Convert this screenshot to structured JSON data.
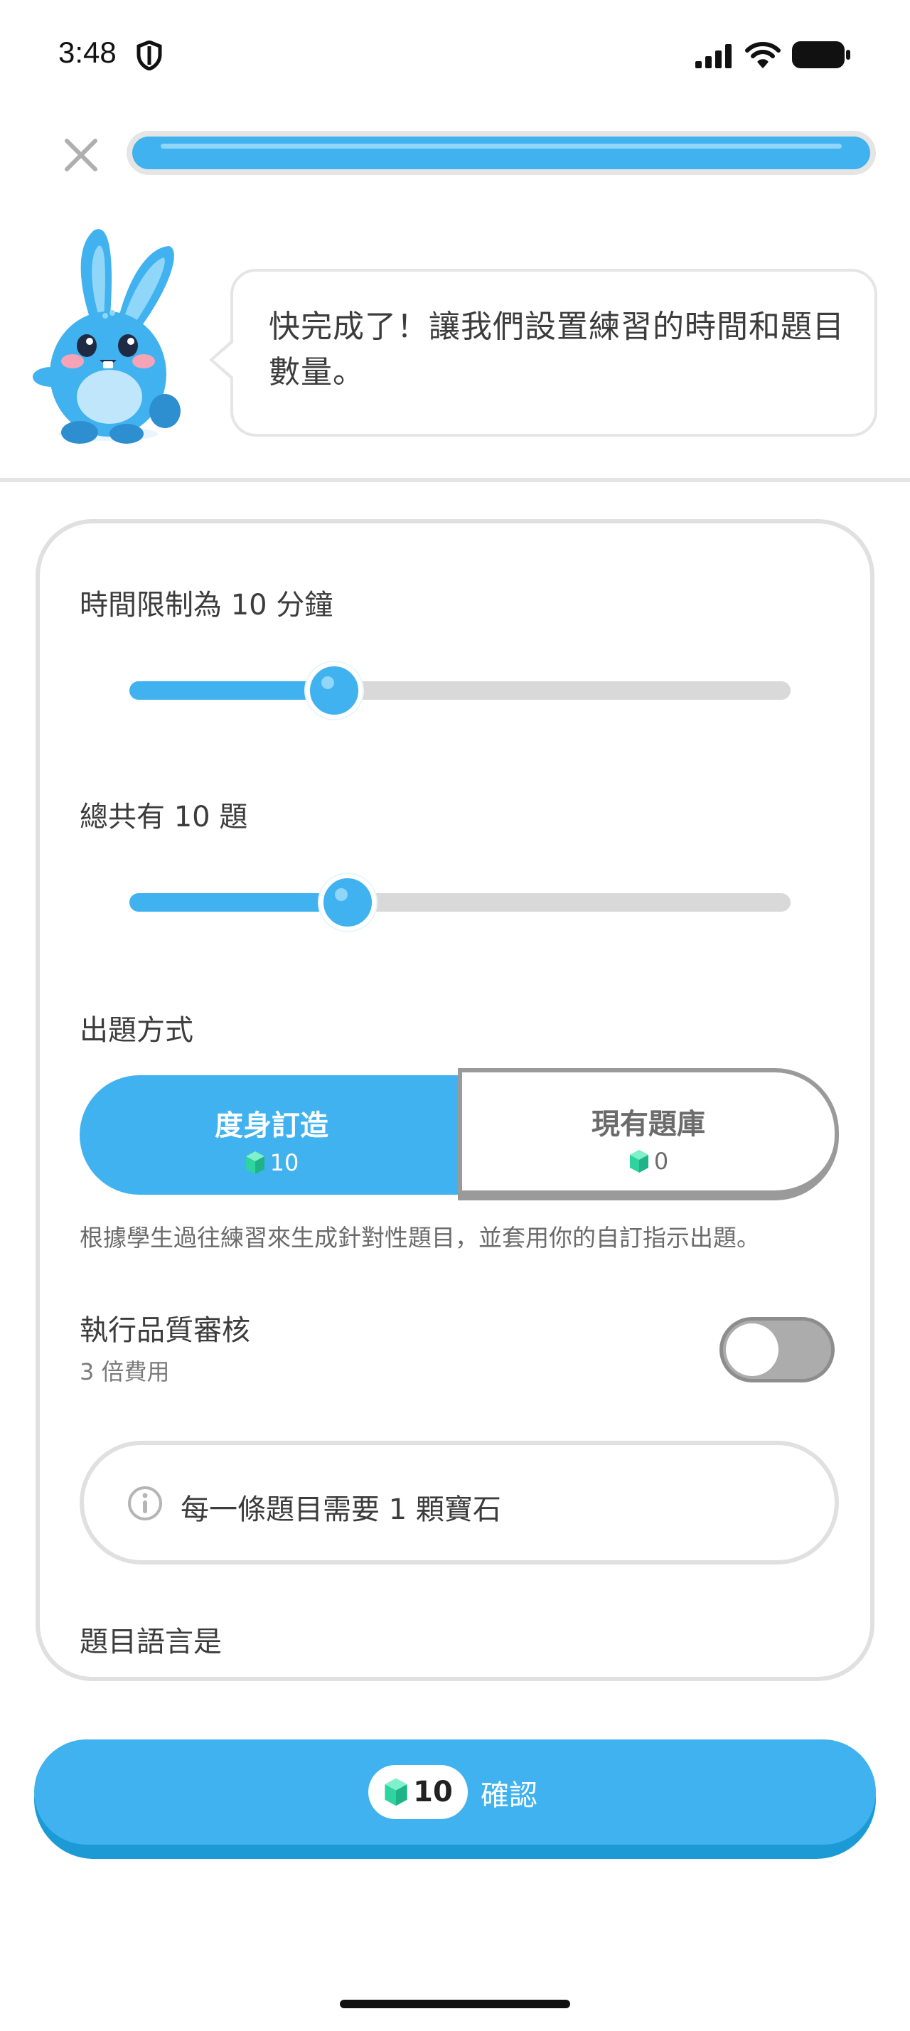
{
  "status_bar": {
    "time": "3:48"
  },
  "progress": {
    "value": 1.0,
    "color": "#3fb2ef"
  },
  "bubble": {
    "message": "快完成了！讓我們設置練習的時間和題目數量。"
  },
  "settings": {
    "time_limit_label": "時間限制為 10 分鐘",
    "time_limit_fraction": 0.31,
    "question_count_label": "總共有 10 題",
    "question_count_fraction": 0.33,
    "mode_heading": "出題方式",
    "mode_options": [
      {
        "label": "度身訂造",
        "cost": "10",
        "selected": true
      },
      {
        "label": "現有題庫",
        "cost": "0",
        "selected": false
      }
    ],
    "mode_description": "根據學生過往練習來生成針對性題目，並套用你的自訂指示出題。",
    "quality_check": {
      "title": "執行品質審核",
      "subtitle": "3 倍費用",
      "enabled": false
    },
    "info_text": "每一條題目需要 1 顆寶石",
    "language_label": "題目語言是"
  },
  "confirm": {
    "cost": "10",
    "label": "確認"
  },
  "colors": {
    "accent": "#3fb2ef",
    "gem": "#2ed3a0",
    "border": "#e5e5e5"
  },
  "icons": [
    "shield-icon",
    "signal-icon",
    "wifi-icon",
    "battery-icon",
    "close-icon",
    "gem-icon",
    "info-icon"
  ]
}
